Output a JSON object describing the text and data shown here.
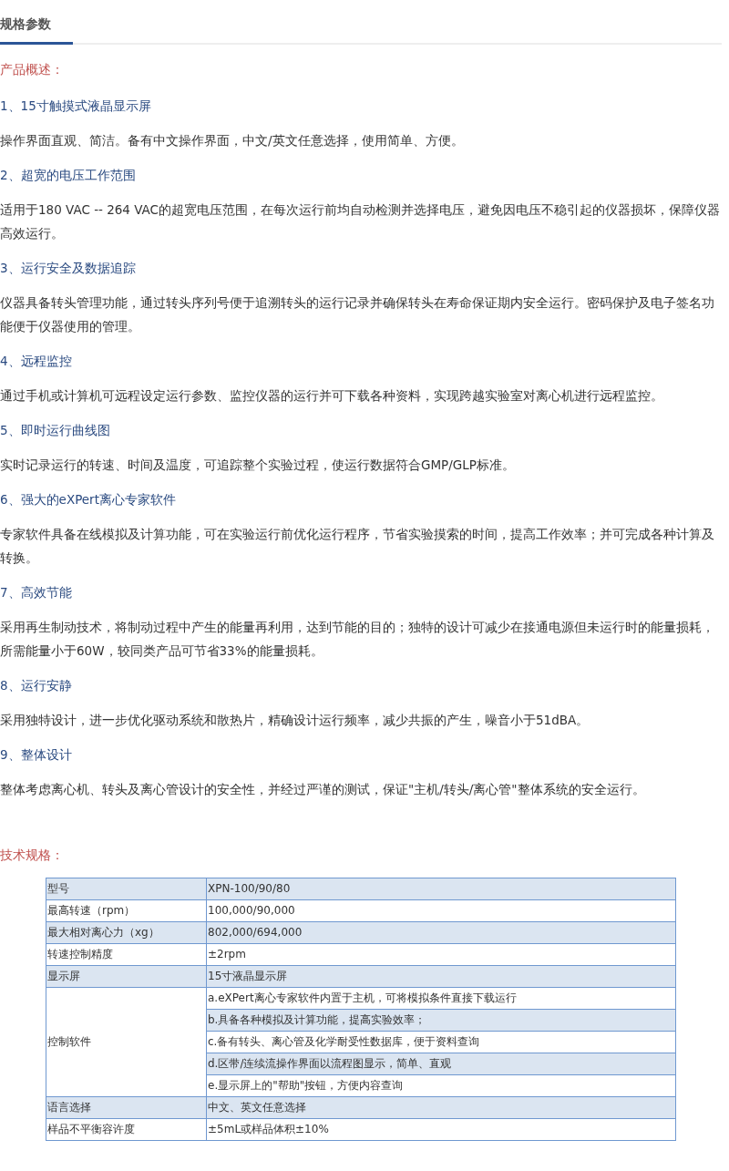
{
  "tab": {
    "label": "规格参数"
  },
  "overview_label": "产品概述：",
  "features": [
    {
      "heading": "1、15寸触摸式液晶显示屏",
      "description": "操作界面直观、简洁。备有中文操作界面，中文/英文任意选择，使用简单、方便。"
    },
    {
      "heading": "2、超宽的电压工作范围",
      "description": "适用于180 VAC -- 264 VAC的超宽电压范围，在每次运行前均自动检测并选择电压，避免因电压不稳引起的仪器损坏，保障仪器高效运行。"
    },
    {
      "heading": "3、运行安全及数据追踪",
      "description": "仪器具备转头管理功能，通过转头序列号便于追溯转头的运行记录并确保转头在寿命保证期内安全运行。密码保护及电子签名功能便于仪器使用的管理。"
    },
    {
      "heading": "4、远程监控",
      "description": "通过手机或计算机可远程设定运行参数、监控仪器的运行并可下载各种资料，实现跨越实验室对离心机进行远程监控。"
    },
    {
      "heading": "5、即时运行曲线图",
      "description": "实时记录运行的转速、时间及温度，可追踪整个实验过程，使运行数据符合GMP/GLP标准。"
    },
    {
      "heading": "6、强大的eXPert离心专家软件",
      "description": "专家软件具备在线模拟及计算功能，可在实验运行前优化运行程序，节省实验摸索的时间，提高工作效率；并可完成各种计算及转换。"
    },
    {
      "heading": "7、高效节能",
      "description": "采用再生制动技术，将制动过程中产生的能量再利用，达到节能的目的；独特的设计可减少在接通电源但未运行时的能量损耗，所需能量小于60W，较同类产品可节省33%的能量损耗。"
    },
    {
      "heading": "8、运行安静",
      "description": "采用独特设计，进一步优化驱动系统和散热片，精确设计运行频率，减少共振的产生，噪音小于51dBA。"
    },
    {
      "heading": "9、整体设计",
      "description": "整体考虑离心机、转头及离心管设计的安全性，并经过严谨的测试，保证\"主机/转头/离心管\"整体系统的安全运行。"
    }
  ],
  "specs_label": "技术规格：",
  "specs_table": {
    "rows": [
      {
        "label": "型号",
        "values": [
          "XPN-100/90/80"
        ]
      },
      {
        "label": "最高转速（rpm）",
        "values": [
          "100,000/90,000"
        ]
      },
      {
        "label": "最大相对离心力（xg）",
        "values": [
          "802,000/694,000"
        ]
      },
      {
        "label": "转速控制精度",
        "values": [
          "±2rpm"
        ]
      },
      {
        "label": "显示屏",
        "values": [
          "15寸液晶显示屏"
        ]
      },
      {
        "label": "控制软件",
        "values": [
          "a.eXPert离心专家软件内置于主机，可将模拟条件直接下载运行",
          "b.具备各种模拟及计算功能，提高实验效率；",
          "c.备有转头、离心管及化学耐受性数据库，便于资料查询",
          "d.区带/连续流操作界面以流程图显示，简单、直观",
          "e.显示屏上的\"帮助\"按钮，方便内容查询"
        ]
      },
      {
        "label": "语言选择",
        "values": [
          "中文、英文任意选择"
        ]
      },
      {
        "label": "样品不平衡容许度",
        "values": [
          "±5mL或样品体积±10%"
        ]
      }
    ]
  }
}
